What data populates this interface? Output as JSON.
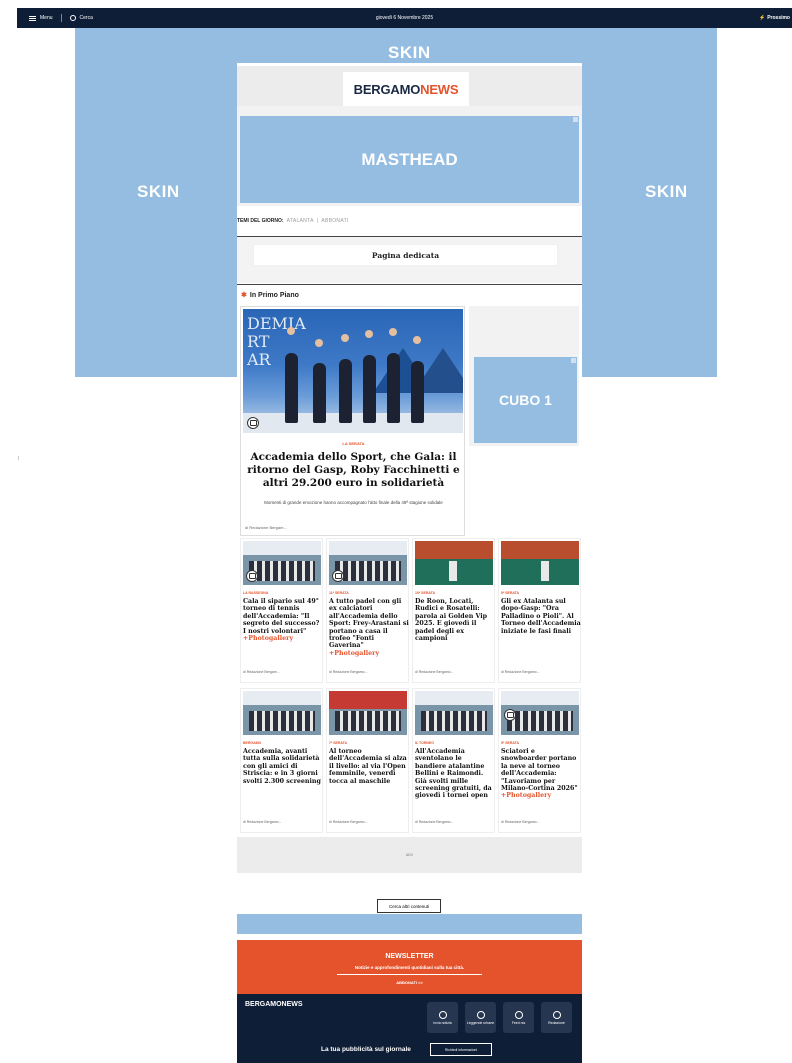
{
  "topbar": {
    "menu_label": "Menu",
    "search_label": "Cerca",
    "date": "giovedì 6 Novembre 2025",
    "right_label": "Prossimo"
  },
  "skin": {
    "top": "SKIN",
    "left": "SKIN",
    "right": "SKIN"
  },
  "logo": {
    "part1": "BERGAMO",
    "part2": "NEWS"
  },
  "masthead": {
    "label": "MASTHEAD"
  },
  "temi": {
    "label": "TEMI DEL GIORNO:",
    "tags": [
      "ATALANTA",
      "ABBONATI"
    ]
  },
  "dedicata": {
    "label": "Pagina dedicata"
  },
  "primo_piano": {
    "label": "In Primo Piano"
  },
  "hero": {
    "photo_text": "DEMIA\nRT\nAR",
    "category": "LA SERATA",
    "title": "Accademia dello Sport, che Gala: il ritorno del Gasp, Roby Facchinetti e altri 29.200 euro in solidarietà",
    "subtitle": "Momenti di grande emozione hanno accompagnato l'atto finale della 49ª stagione solidale",
    "author": "di Redazione Bergam..."
  },
  "cubo": {
    "label": "CUBO 1"
  },
  "cards_row1": [
    {
      "category": "LA RASSEGNA",
      "title": "Cala il sipario sul 49° torneo di tennis dell'Accademia: \"Il segreto del successo? I nostri volontari\"",
      "highlight": "+Photogallery",
      "author": "di Redazione Bergam..."
    },
    {
      "category": "11ª SERATA",
      "title": "A tutto padel con gli ex calciatori all'Accademia dello Sport: Frey-Arastani si portano a casa il trofeo \"Fonti Gaverina\"",
      "highlight": "+Photogallery",
      "author": "di Redazione Bergamo..."
    },
    {
      "category": "10ª SERATA",
      "title": "De Roon, Locati, Rudici e Rosatelli: parola ai Golden Vip 2025. E giovedì il padel degli ex campioni",
      "highlight": "",
      "author": "di Redazione Bergamo..."
    },
    {
      "category": "9ª SERATA",
      "title": "Gli ex Atalanta sul dopo-Gasp: \"Ora Palladino o Pioli\". Al Torneo dell'Accademia iniziate le fasi finali",
      "highlight": "",
      "author": "di Redazione Bergamo..."
    }
  ],
  "cards_row2": [
    {
      "category": "BERGAMO",
      "title": "Accademia, avanti tutta sulla solidarietà con gli amici di Striscia: e in 3 giorni svolti 2.300 screening",
      "highlight": "",
      "author": "di Redazione Bergamo..."
    },
    {
      "category": "7ª SERATA",
      "title": "Al torneo dell'Accademia si alza il livello: al via l'Open femminile, venerdì tocca al maschile",
      "highlight": "",
      "author": "di Redazione Bergamo..."
    },
    {
      "category": "IL TORNEO",
      "title": "All'Accademia sventolano le bandiere atalantine Bellini e Raimondi. Già svolti mille screening gratuiti, da giovedì i tornei open",
      "highlight": "",
      "author": "di Redazione Bergamo..."
    },
    {
      "category": "5ª SERATA",
      "title": "Sciatori e snowboarder portano la neve al torneo dell'Accademia: \"Lavoriamo per Milano-Cortina 2026\"",
      "highlight": "+Photogallery",
      "author": "di Redazione Bergamo..."
    }
  ],
  "adv": {
    "label": "ADV"
  },
  "cerca_btn": {
    "label": "Cerca altri contenuti"
  },
  "newsletter": {
    "heading": "NEWSLETTER",
    "sub": "Notizie e approfondimenti quotidiani sulla tua città.",
    "action": "ABBONATI >>"
  },
  "footer": {
    "brand": "BERGAMONEWS",
    "buttons": [
      {
        "label": "Invia notizia",
        "icon": "send-icon"
      },
      {
        "label": "Leggende urbane",
        "icon": "info-icon"
      },
      {
        "label": "Feed rss",
        "icon": "rss-icon"
      },
      {
        "label": "Redazione",
        "icon": "phone-icon"
      }
    ],
    "pub_text": "La tua pubblicità sul giornale",
    "pub_button": "Richiedi informazioni"
  },
  "colors": {
    "accent": "#e4532c",
    "navy": "#0e1e36",
    "ad_blue": "#94bde1"
  }
}
